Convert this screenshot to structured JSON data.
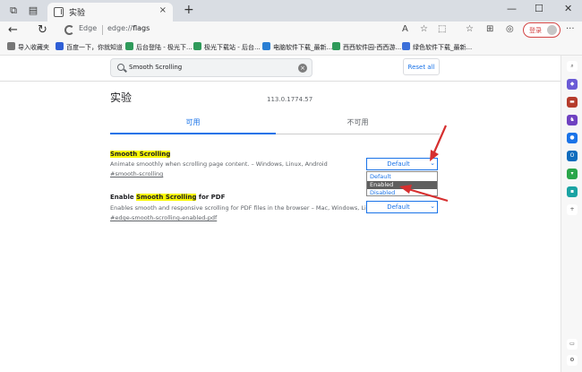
{
  "tab": {
    "title": "实验",
    "close": "×",
    "new_tab": "+"
  },
  "window_controls": {
    "minimize": "—",
    "maximize": "☐",
    "close": "✕"
  },
  "toolbar": {
    "back": "←",
    "refresh": "↻",
    "brand": "Edge",
    "url_scheme": "edge://",
    "url_host": "flags",
    "login_label": "登录",
    "more": "···"
  },
  "favorites": [
    {
      "label": "导入收藏夹",
      "color": "#777777"
    },
    {
      "label": "百度一下，你就知道",
      "color": "#2f5fd6"
    },
    {
      "label": "后台登陆 - 极光下...",
      "color": "#2f9a5a"
    },
    {
      "label": "极光下载站 - 后台...",
      "color": "#2f9a5a"
    },
    {
      "label": "电脑软件下载_最新...",
      "color": "#2a7fd4"
    },
    {
      "label": "西西软件园-西西游...",
      "color": "#2f9a5a"
    },
    {
      "label": "绿色软件下载_最新...",
      "color": "#3b6fd9"
    }
  ],
  "search": {
    "value": "Smooth Scrolling",
    "clear": "×"
  },
  "reset_label": "Reset all",
  "page": {
    "title": "实验",
    "version": "113.0.1774.57",
    "tab_available": "可用",
    "tab_unavailable": "不可用"
  },
  "experiments": [
    {
      "title_highlight": "Smooth Scrolling",
      "description": "Animate smoothly when scrolling page content. – Windows, Linux, Android",
      "link": "#smooth-scrolling",
      "selected": "Default"
    },
    {
      "title_prefix": "Enable ",
      "title_highlight": "Smooth Scrolling",
      "title_suffix": " for PDF",
      "description": "Enables smooth and responsive scrolling for PDF files in the browser – Mac, Windows, Linux",
      "link": "#edge-smooth-scrolling-enabled-pdf",
      "selected": "Default"
    }
  ],
  "dropdown_options": [
    "Default",
    "Enabled",
    "Disabled"
  ],
  "dropdown_highlighted": "Enabled",
  "colors": {
    "accent": "#1a73e8",
    "highlight": "#f9f800",
    "arrow": "#d62f2f"
  }
}
